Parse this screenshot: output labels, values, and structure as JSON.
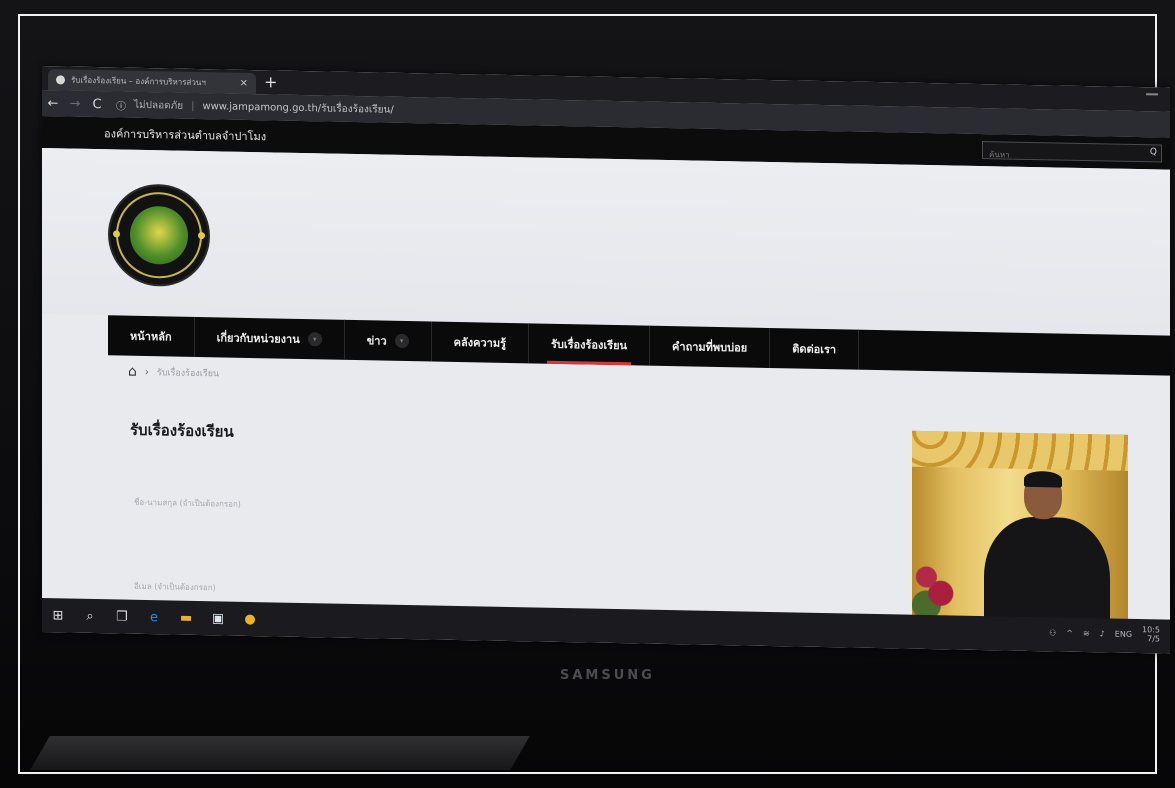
{
  "browser": {
    "tab_title": "รับเรื่องร้องเรียน – องค์การบริหารส่วนฯ",
    "tab_close": "×",
    "new_tab": "+",
    "back_glyph": "←",
    "forward_glyph": "→",
    "reload_glyph": "C",
    "security_label": "ไม่ปลอดภัย",
    "url": "www.jampamong.go.th/รับเรื่องร้องเรียน/"
  },
  "site": {
    "name": "องค์การบริหารส่วนตำบลจำปาโมง",
    "search_placeholder": "ค้นหา",
    "search_glyph": "Q"
  },
  "nav": {
    "items": [
      {
        "label": "หน้าหลัก",
        "has_dropdown": false,
        "active": false
      },
      {
        "label": "เกี่ยวกับหน่วยงาน",
        "has_dropdown": true,
        "active": false
      },
      {
        "label": "ข่าว",
        "has_dropdown": true,
        "active": false
      },
      {
        "label": "คลังความรู้",
        "has_dropdown": false,
        "active": false
      },
      {
        "label": "รับเรื่องร้องเรียน",
        "has_dropdown": false,
        "active": true
      },
      {
        "label": "คำถามที่พบบ่อย",
        "has_dropdown": false,
        "active": false
      },
      {
        "label": "ติดต่อเรา",
        "has_dropdown": false,
        "active": false
      }
    ],
    "dropdown_glyph": "▾"
  },
  "breadcrumb": {
    "home_glyph": "⌂",
    "arrow": "›",
    "current": "รับเรื่องร้องเรียน"
  },
  "page": {
    "title": "รับเรื่องร้องเรียน",
    "field_1_label": "ชื่อ-นามสกุล (จำเป็นต้องกรอก)",
    "field_2_label": "อีเมล (จำเป็นต้องกรอก)"
  },
  "taskbar": {
    "tray_lang": "ENG",
    "tray_time": "10:5",
    "tray_date": "7/5"
  },
  "monitor": {
    "brand": "SAMSUNG"
  },
  "colors": {
    "nav_bg": "#0a0a0b",
    "active_underline": "#d8373a",
    "page_bg": "#e9eaee"
  }
}
